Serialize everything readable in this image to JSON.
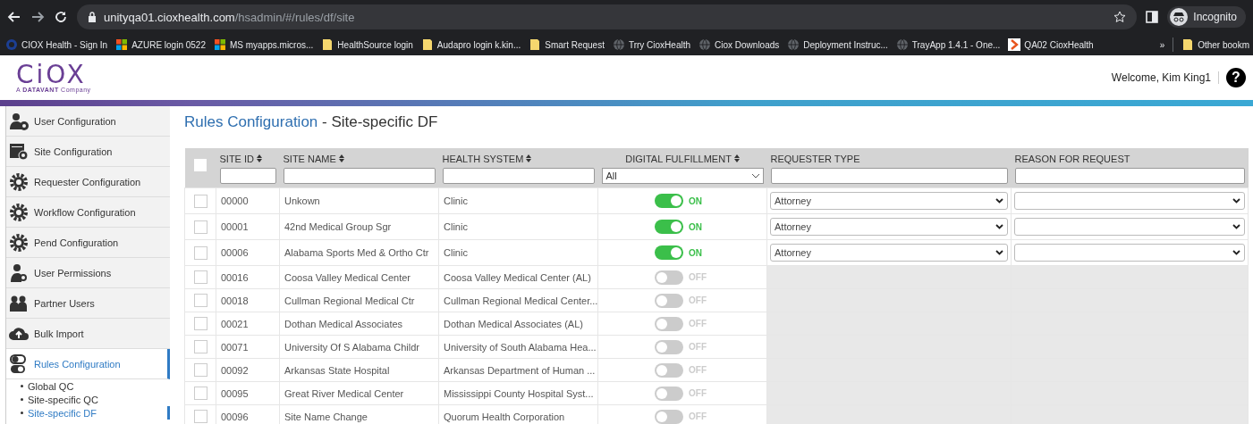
{
  "browser": {
    "url_host": "unityqa01.cioxhealth.com",
    "url_path": "/hsadmin/#/rules/df/site",
    "profile_label": "Incognito",
    "bookmarks": [
      {
        "kind": "ring",
        "label": "CIOX Health - Sign In"
      },
      {
        "kind": "tiles",
        "label": "AZURE login 0522"
      },
      {
        "kind": "tiles",
        "label": "MS  myapps.micros..."
      },
      {
        "kind": "folder",
        "label": "HealthSource login"
      },
      {
        "kind": "folder",
        "label": "Audapro login k.kin..."
      },
      {
        "kind": "folder",
        "label": "Smart Request"
      },
      {
        "kind": "globe",
        "label": "Trry CioxHealth"
      },
      {
        "kind": "globe",
        "label": "Ciox Downloads"
      },
      {
        "kind": "globe",
        "label": "Deployment Instruc..."
      },
      {
        "kind": "globe",
        "label": "TrayApp 1.4.1 - One..."
      },
      {
        "kind": "chevron",
        "label": "QA02 CioxHealth"
      }
    ],
    "overflow": "»",
    "other_label": "Other bookm"
  },
  "header": {
    "logo": "CiOX",
    "tagline": "A **DATAVANT** Company",
    "welcome": "Welcome, Kim King1",
    "help": "?"
  },
  "sidebar": {
    "items": [
      {
        "kind": "user-gear",
        "label": "User Configuration",
        "selected": false
      },
      {
        "kind": "window-gear",
        "label": "Site Configuration",
        "selected": false
      },
      {
        "kind": "gear",
        "label": "Requester Configuration",
        "selected": false
      },
      {
        "kind": "gear",
        "label": "Workflow Configuration",
        "selected": false
      },
      {
        "kind": "gear",
        "label": "Pend Configuration",
        "selected": false
      },
      {
        "kind": "user-key",
        "label": "User Permissions",
        "selected": false
      },
      {
        "kind": "people",
        "label": "Partner Users",
        "selected": false
      },
      {
        "kind": "cloud",
        "label": "Bulk Import",
        "selected": false
      },
      {
        "kind": "toggles",
        "label": "Rules Configuration",
        "selected": true,
        "children": [
          {
            "label": "Global QC",
            "selected": false
          },
          {
            "label": "Site-specific QC",
            "selected": false
          },
          {
            "label": "Site-specific DF",
            "selected": true
          }
        ]
      }
    ]
  },
  "page_title": {
    "section": "Rules Configuration",
    "subtitle": " - Site-specific DF"
  },
  "table": {
    "select_all": {
      "checked": false
    },
    "columns": [
      {
        "label": "SITE ID",
        "sortable": true,
        "filter": {
          "kind": "text"
        }
      },
      {
        "label": "SITE NAME",
        "sortable": true,
        "filter": {
          "kind": "text"
        }
      },
      {
        "label": "HEALTH SYSTEM",
        "sortable": true,
        "filter": {
          "kind": "text"
        }
      },
      {
        "label": "DIGITAL FULFILLMENT",
        "sortable": true,
        "filter": {
          "kind": "select",
          "value": "All"
        }
      },
      {
        "label": "REQUESTER TYPE",
        "sortable": false,
        "filter": {
          "kind": "text"
        }
      },
      {
        "label": "REASON FOR REQUEST",
        "sortable": false,
        "filter": {
          "kind": "text"
        }
      }
    ],
    "rows": [
      {
        "checked": false,
        "site_id": "00000",
        "site_name": "Unkown",
        "health_system": "Clinic",
        "df": {
          "on": true,
          "label": "ON"
        },
        "requester_type": "Attorney"
      },
      {
        "checked": false,
        "site_id": "00001",
        "site_name": "42nd Medical Group Sgr",
        "health_system": "Clinic",
        "df": {
          "on": true,
          "label": "ON"
        },
        "requester_type": "Attorney"
      },
      {
        "checked": false,
        "site_id": "00006",
        "site_name": "Alabama Sports Med & Ortho Ctr",
        "health_system": "Clinic",
        "df": {
          "on": true,
          "label": "ON"
        },
        "requester_type": "Attorney"
      },
      {
        "checked": false,
        "site_id": "00016",
        "site_name": "Coosa Valley Medical Center",
        "health_system": "Coosa Valley Medical Center (AL)",
        "df": {
          "on": false,
          "label": "OFF"
        }
      },
      {
        "checked": false,
        "site_id": "00018",
        "site_name": "Cullman Regional Medical Ctr",
        "health_system": "Cullman Regional Medical Center...",
        "df": {
          "on": false,
          "label": "OFF"
        }
      },
      {
        "checked": false,
        "site_id": "00021",
        "site_name": "Dothan Medical Associates",
        "health_system": "Dothan Medical Associates (AL)",
        "df": {
          "on": false,
          "label": "OFF"
        }
      },
      {
        "checked": false,
        "site_id": "00071",
        "site_name": "University Of S Alabama Childr",
        "health_system": "University of South Alabama Hea...",
        "df": {
          "on": false,
          "label": "OFF"
        }
      },
      {
        "checked": false,
        "site_id": "00092",
        "site_name": "Arkansas State Hospital",
        "health_system": "Arkansas Department of Human ...",
        "df": {
          "on": false,
          "label": "OFF"
        }
      },
      {
        "checked": false,
        "site_id": "00095",
        "site_name": "Great River Medical Center",
        "health_system": "Mississippi County Hospital Syst...",
        "df": {
          "on": false,
          "label": "OFF"
        }
      },
      {
        "checked": false,
        "site_id": "00096",
        "site_name": "Site Name Change",
        "health_system": "Quorum Health Corporation",
        "df": {
          "on": false,
          "label": "OFF"
        }
      }
    ]
  }
}
